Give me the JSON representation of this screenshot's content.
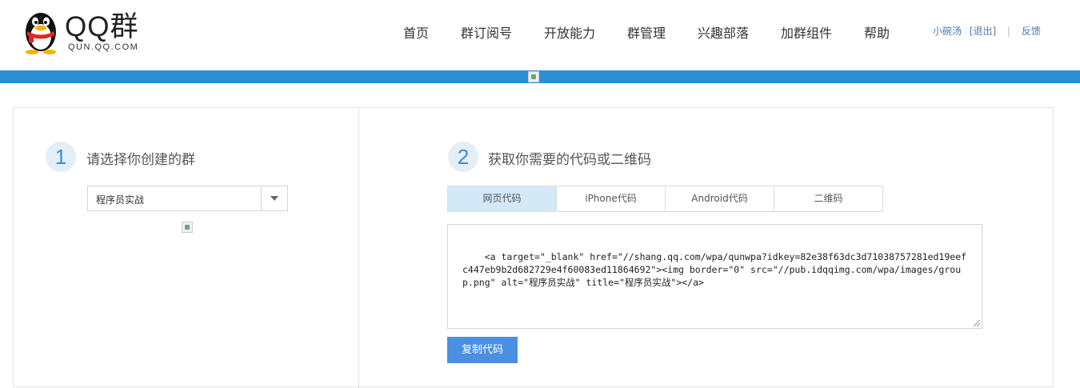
{
  "header": {
    "logo_text": "QQ群",
    "logo_subtext": "QUN.QQ.COM",
    "nav": [
      {
        "label": "首页",
        "name": "nav-home"
      },
      {
        "label": "群订阅号",
        "name": "nav-subscription"
      },
      {
        "label": "开放能力",
        "name": "nav-open"
      },
      {
        "label": "群管理",
        "name": "nav-manage"
      },
      {
        "label": "兴趣部落",
        "name": "nav-tribe"
      },
      {
        "label": "加群组件",
        "name": "nav-widget"
      },
      {
        "label": "帮助",
        "name": "nav-help"
      }
    ],
    "user": {
      "username": "小碗汤",
      "logout": "[退出]",
      "separator": "|",
      "feedback": "反馈"
    }
  },
  "colors": {
    "brand_blue": "#2b8fd3",
    "button_blue": "#4a90e2",
    "active_tab": "#d3e9f8"
  },
  "step1": {
    "number": "1",
    "title": "请选择你创建的群",
    "select_value": "程序员实战"
  },
  "step2": {
    "number": "2",
    "title": "获取你需要的代码或二维码",
    "tabs": [
      "网页代码",
      "iPhone代码",
      "Android代码",
      "二维码"
    ],
    "active_tab": 0,
    "code": "<a target=\"_blank\" href=\"//shang.qq.com/wpa/qunwpa?idkey=82e38f63dc3d71038757281ed19eefc447eb9b2d682729e4f60083ed11864692\"><img border=\"0\" src=\"//pub.idqqimg.com/wpa/images/group.png\" alt=\"程序员实战\" title=\"程序员实战\"></a>",
    "copy_button": "复制代码"
  }
}
